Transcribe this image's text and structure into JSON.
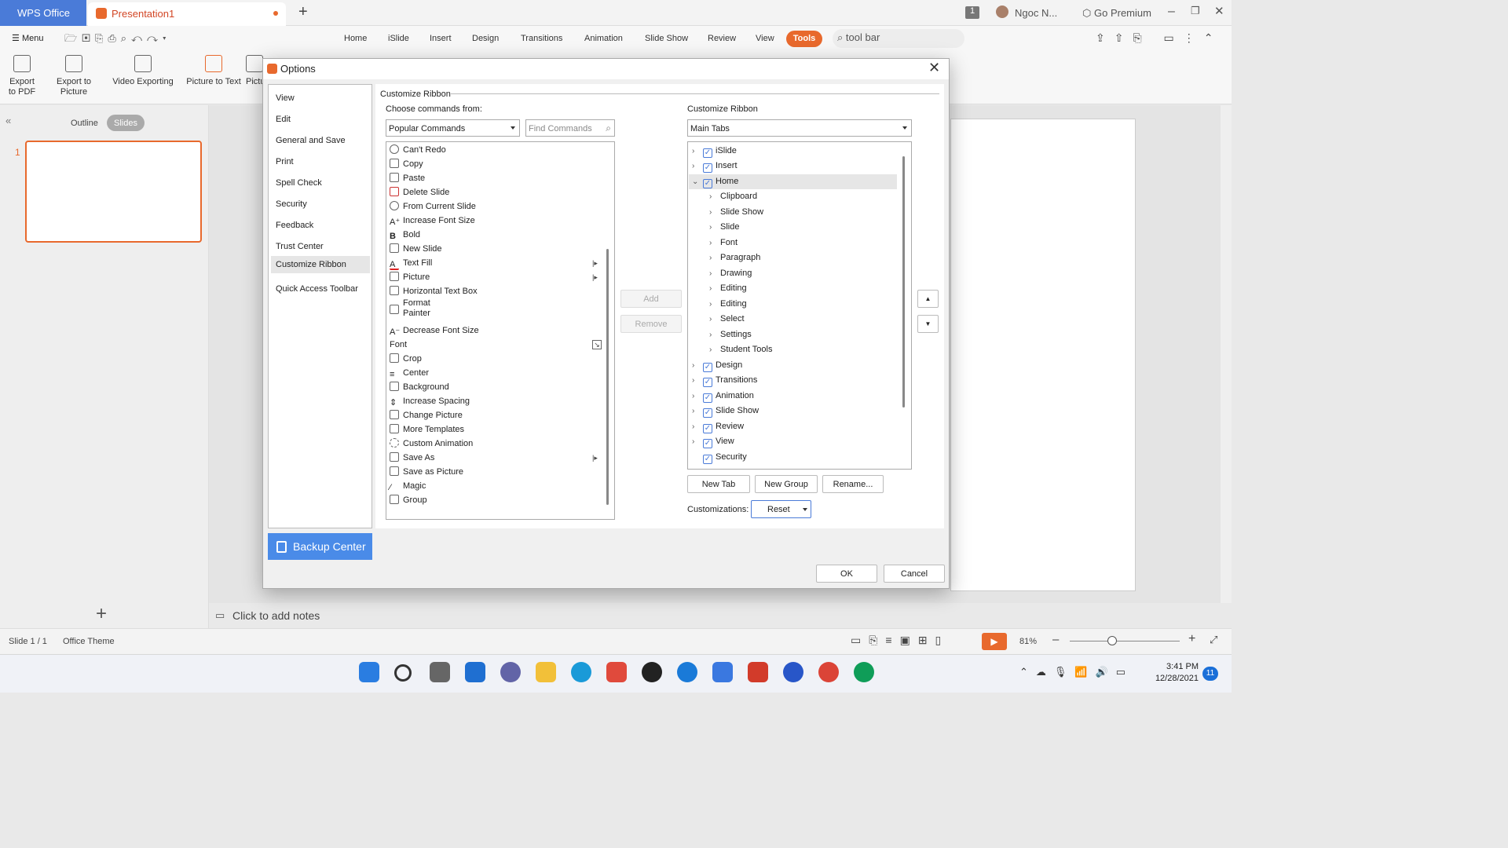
{
  "titlebar": {
    "wps_tab": "WPS Office",
    "doc_tab": "Presentation1",
    "page_badge": "1",
    "user": "Ngoc N...",
    "premium": "Go Premium"
  },
  "menubar": {
    "menu": "Menu",
    "tabs": [
      "Home",
      "iSlide",
      "Insert",
      "Design",
      "Transitions",
      "Animation",
      "Slide Show",
      "Review",
      "View"
    ],
    "tools": "Tools",
    "search": "tool bar"
  },
  "ribbon": {
    "items": [
      "Export to PDF",
      "Export to Picture",
      "Video Exporting",
      "Picture to Text",
      "Pictu"
    ]
  },
  "leftpane": {
    "outline": "Outline",
    "slides": "Slides",
    "slide_num": "1"
  },
  "notes": "Click to add notes",
  "status": {
    "slide": "Slide 1 / 1",
    "theme": "Office Theme",
    "zoom": "81%"
  },
  "taskbar": {
    "time": "3:41 PM",
    "date": "12/28/2021",
    "badge": "11"
  },
  "dialog": {
    "title": "Options",
    "nav": [
      "View",
      "Edit",
      "General and Save",
      "Print",
      "Spell Check",
      "Security",
      "Feedback",
      "Trust Center",
      "Customize Ribbon",
      "Quick Access Toolbar"
    ],
    "backup": "Backup Center",
    "section": "Customize Ribbon",
    "choose_label": "Choose commands from:",
    "choose_value": "Popular Commands",
    "find_placeholder": "Find Commands",
    "commands": [
      "Can't Redo",
      "Copy",
      "Paste",
      "Delete Slide",
      "From Current Slide",
      "Increase Font Size",
      "Bold",
      "New Slide",
      "Text Fill",
      "Picture",
      "Horizontal Text Box",
      "Format",
      "Painter",
      "Decrease Font Size",
      "Font",
      "Crop",
      "Center",
      "Background",
      "Increase Spacing",
      "Change Picture",
      "More Templates",
      "Custom Animation",
      "Save As",
      "Save as Picture",
      "Magic",
      "Group"
    ],
    "add": "Add",
    "remove": "Remove",
    "customize_label": "Customize Ribbon",
    "customize_value": "Main Tabs",
    "tree_top": [
      "iSlide",
      "Insert",
      "Home"
    ],
    "tree_home": [
      "Clipboard",
      "Slide Show",
      "Slide",
      "Font",
      "Paragraph",
      "Drawing",
      "Editing",
      "Editing",
      "Select",
      "Settings",
      "Student Tools"
    ],
    "tree_bottom": [
      "Design",
      "Transitions",
      "Animation",
      "Slide Show",
      "Review",
      "View",
      "Security"
    ],
    "new_tab": "New Tab",
    "new_group": "New Group",
    "rename": "Rename...",
    "customizations": "Customizations:",
    "reset": "Reset",
    "ok": "OK",
    "cancel": "Cancel"
  }
}
